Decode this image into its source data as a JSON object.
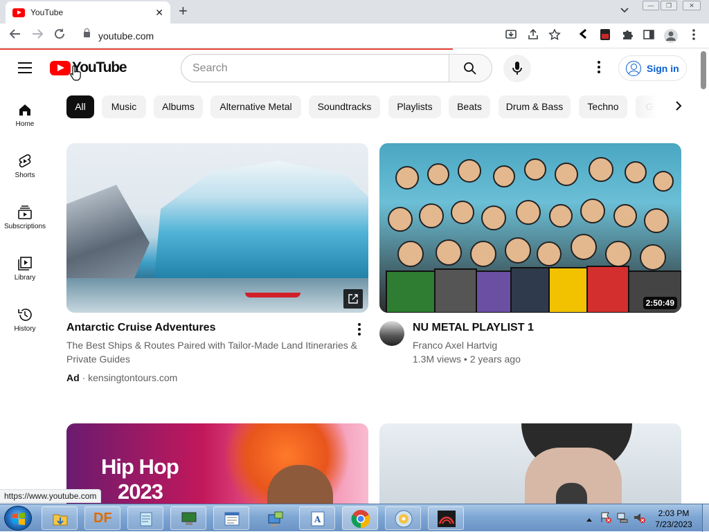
{
  "browser": {
    "tab_title": "YouTube",
    "tab_close": "✕",
    "new_tab": "+",
    "tab_dropdown": "⌄",
    "url": "youtube.com"
  },
  "header": {
    "logo_text": "YouTube",
    "search_placeholder": "Search",
    "signin_label": "Sign in"
  },
  "chips": [
    "All",
    "Music",
    "Albums",
    "Alternative Metal",
    "Soundtracks",
    "Playlists",
    "Beats",
    "Drum & Bass",
    "Techno",
    "G"
  ],
  "sidebar": [
    {
      "label": "Home"
    },
    {
      "label": "Shorts"
    },
    {
      "label": "Subscriptions"
    },
    {
      "label": "Library"
    },
    {
      "label": "History"
    }
  ],
  "videos": [
    {
      "title": "Antarctic Cruise Adventures",
      "description": "The Best Ships & Routes Paired with Tailor-Made Land Itineraries & Private Guides",
      "ad_label": "Ad",
      "ad_separator": "·",
      "ad_domain": "kensingtontours.com"
    },
    {
      "title": "NU METAL PLAYLIST 1",
      "channel": "Franco Axel Hartvig",
      "meta": "1.3M views • 2 years ago",
      "duration": "2:50:49"
    },
    {
      "thumb_text_line1": "Hip Hop",
      "thumb_text_line2": "2023"
    },
    {}
  ],
  "status_url": "https://www.youtube.com",
  "clock": {
    "time": "2:03 PM",
    "date": "7/23/2023"
  },
  "taskbar": {
    "df_label": "DF"
  },
  "colors": {
    "brand_red": "#ff0000",
    "link_blue": "#065fd4",
    "active_chip": "#0f0f0f"
  }
}
